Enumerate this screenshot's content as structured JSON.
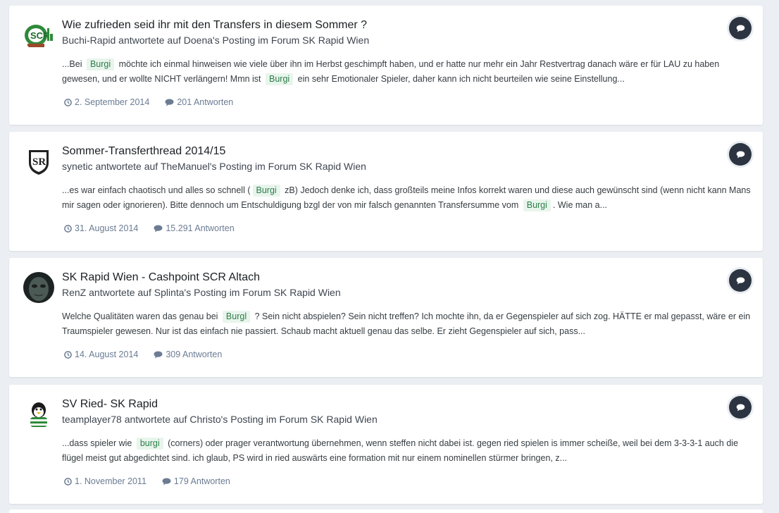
{
  "results": [
    {
      "title": "Wie zufrieden seid ihr mit den Transfers in diesem Sommer ?",
      "meta": "Buchi-Rapid antwortete auf Doena's Posting im Forum SK Rapid Wien",
      "snippet": [
        {
          "t": "...Bei "
        },
        {
          "hl": "Burgi"
        },
        {
          "t": " möchte ich einmal hinweisen wie viele über ihn im Herbst geschimpft haben, und er hatte nur mehr ein Jahr Restvertrag danach wäre er für LAU zu haben gewesen, und er wollte NICHT verlängern! Mmn ist "
        },
        {
          "hl": "Burgi"
        },
        {
          "t": " ein sehr Emotionaler Spieler, daher kann ich nicht beurteilen wie seine Einstellung..."
        }
      ],
      "date": "2. September 2014",
      "replies": "201 Antworten",
      "avatar_icon": "rapid-logo-avatar"
    },
    {
      "title": "Sommer-Transferthread 2014/15",
      "meta": "synetic antwortete auf TheManuel's Posting im Forum SK Rapid Wien",
      "snippet": [
        {
          "t": "...es war einfach chaotisch und alles so schnell ("
        },
        {
          "hl": "Burgi"
        },
        {
          "t": " zB) Jedoch denke ich, dass großteils meine Infos korrekt waren und diese auch gewünscht sind (wenn nicht kann Mans mir sagen oder ignorieren). Bitte dennoch um Entschuldigung bzgl der von mir falsch genannten Transfersumme vom "
        },
        {
          "hl": "Burgi"
        },
        {
          "t": ". Wie man a..."
        }
      ],
      "date": "31. August 2014",
      "replies": "15.291 Antworten",
      "avatar_icon": "scr-crest-avatar"
    },
    {
      "title": "SK Rapid Wien - Cashpoint SCR Altach",
      "meta": "RenZ antwortete auf Splinta's Posting im Forum SK Rapid Wien",
      "snippet": [
        {
          "t": "Welche Qualitäten waren das genau bei "
        },
        {
          "hl": "Burgl"
        },
        {
          "t": " ? Sein nicht abspielen? Sein nicht treffen? Ich mochte ihn, da er Gegenspieler auf sich zog. HÄTTE er mal gepasst, wäre er ein Traumspieler gewesen. Nur ist das einfach nie passiert. Schaub macht aktuell genau das selbe. Er zieht Gegenspieler auf sich, pass..."
        }
      ],
      "date": "14. August 2014",
      "replies": "309 Antworten",
      "avatar_icon": "dark-face-avatar"
    },
    {
      "title": "SV Ried- SK Rapid",
      "meta": "teamplayer78 antwortete auf Christo's Posting im Forum SK Rapid Wien",
      "snippet": [
        {
          "t": "...dass spieler wie "
        },
        {
          "hl": "burgi"
        },
        {
          "t": " (corners) oder prager verantwortung übernehmen, wenn steffen nicht dabei ist. gegen ried spielen is immer scheiße, weil bei dem 3-3-3-1 auch die flügel meist gut abgedichtet sind. ich glaub, PS wird in ried auswärts eine formation mit nur einem nominellen stürmer bringen, z..."
        }
      ],
      "date": "1. November 2011",
      "replies": "179 Antworten",
      "avatar_icon": "penguin-avatar"
    }
  ],
  "colors": {
    "accent_highlight_bg": "#e8f5ec",
    "accent_highlight_text": "#2e7e4a",
    "reply_button": "#2b3440",
    "stat_text": "#6b7c93"
  }
}
